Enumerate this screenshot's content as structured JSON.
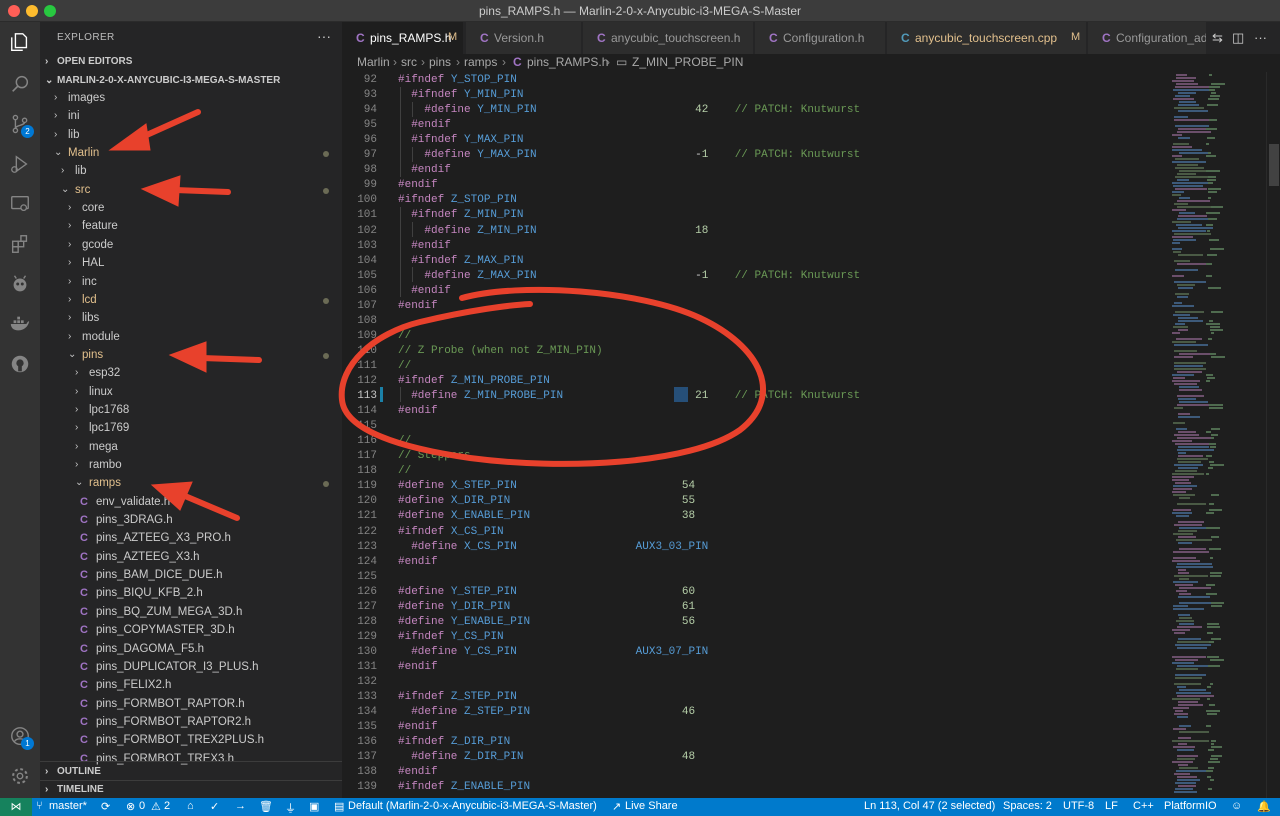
{
  "window": {
    "title": "pins_RAMPS.h — Marlin-2-0-x-Anycubic-i3-MEGA-S-Master"
  },
  "activity": {
    "scm_badge": "2",
    "accounts_badge": "1"
  },
  "explorer": {
    "header": "EXPLORER",
    "more": "···",
    "open_editors": "OPEN EDITORS",
    "root": "MARLIN-2-0-X-ANYCUBIC-I3-MEGA-S-MASTER",
    "outline": "OUTLINE",
    "timeline": "TIMELINE",
    "items": [
      {
        "label": "images",
        "type": "folder",
        "expanded": false,
        "modified": false
      },
      {
        "label": "ini",
        "type": "folder",
        "expanded": false,
        "modified": false
      },
      {
        "label": "lib",
        "type": "folder",
        "expanded": false,
        "modified": false
      },
      {
        "label": "Marlin",
        "type": "folder",
        "expanded": true,
        "modified": true
      },
      {
        "label": "lib",
        "type": "folder",
        "expanded": false,
        "modified": false
      },
      {
        "label": "src",
        "type": "folder",
        "expanded": true,
        "modified": true
      },
      {
        "label": "core",
        "type": "folder",
        "expanded": false,
        "modified": false
      },
      {
        "label": "feature",
        "type": "folder",
        "expanded": false,
        "modified": false
      },
      {
        "label": "gcode",
        "type": "folder",
        "expanded": false,
        "modified": false
      },
      {
        "label": "HAL",
        "type": "folder",
        "expanded": false,
        "modified": false
      },
      {
        "label": "inc",
        "type": "folder",
        "expanded": false,
        "modified": false
      },
      {
        "label": "lcd",
        "type": "folder",
        "expanded": false,
        "modified": true
      },
      {
        "label": "libs",
        "type": "folder",
        "expanded": false,
        "modified": false
      },
      {
        "label": "module",
        "type": "folder",
        "expanded": false,
        "modified": false
      },
      {
        "label": "pins",
        "type": "folder",
        "expanded": true,
        "modified": true
      },
      {
        "label": "esp32",
        "type": "folder",
        "expanded": false,
        "modified": false
      },
      {
        "label": "linux",
        "type": "folder",
        "expanded": false,
        "modified": false
      },
      {
        "label": "lpc1768",
        "type": "folder",
        "expanded": false,
        "modified": false
      },
      {
        "label": "lpc1769",
        "type": "folder",
        "expanded": false,
        "modified": false
      },
      {
        "label": "mega",
        "type": "folder",
        "expanded": false,
        "modified": false
      },
      {
        "label": "rambo",
        "type": "folder",
        "expanded": false,
        "modified": false
      },
      {
        "label": "ramps",
        "type": "folder",
        "expanded": true,
        "modified": true
      },
      {
        "label": "env_validate.h",
        "type": "file"
      },
      {
        "label": "pins_3DRAG.h",
        "type": "file"
      },
      {
        "label": "pins_AZTEEG_X3_PRO.h",
        "type": "file"
      },
      {
        "label": "pins_AZTEEG_X3.h",
        "type": "file"
      },
      {
        "label": "pins_BAM_DICE_DUE.h",
        "type": "file"
      },
      {
        "label": "pins_BIQU_KFB_2.h",
        "type": "file"
      },
      {
        "label": "pins_BQ_ZUM_MEGA_3D.h",
        "type": "file"
      },
      {
        "label": "pins_COPYMASTER_3D.h",
        "type": "file"
      },
      {
        "label": "pins_DAGOMA_F5.h",
        "type": "file"
      },
      {
        "label": "pins_DUPLICATOR_I3_PLUS.h",
        "type": "file"
      },
      {
        "label": "pins_FELIX2.h",
        "type": "file"
      },
      {
        "label": "pins_FORMBOT_RAPTOR.h",
        "type": "file"
      },
      {
        "label": "pins_FORMBOT_RAPTOR2.h",
        "type": "file"
      },
      {
        "label": "pins_FORMBOT_TREX2PLUS.h",
        "type": "file"
      },
      {
        "label": "pins_FORMBOT_TREX3.h",
        "type": "file"
      }
    ]
  },
  "tabs": [
    {
      "label": "pins_RAMPS.h",
      "status": "M",
      "active": true
    },
    {
      "label": "Version.h",
      "status": "",
      "active": false
    },
    {
      "label": "anycubic_touchscreen.h",
      "status": "",
      "active": false
    },
    {
      "label": "Configuration.h",
      "status": "",
      "active": false
    },
    {
      "label": "anycubic_touchscreen.cpp",
      "status": "M",
      "active": false
    },
    {
      "label": "Configuration_adv",
      "status": "",
      "active": false
    }
  ],
  "breadcrumb": [
    "Marlin",
    "src",
    "pins",
    "ramps",
    "pins_RAMPS.h",
    "Z_MIN_PROBE_PIN"
  ],
  "editor": {
    "current_line": 113,
    "lines": [
      {
        "n": 92,
        "t": "#ifndef Y_STOP_PIN"
      },
      {
        "n": 93,
        "t": "  #ifndef Y_MIN_PIN"
      },
      {
        "n": 94,
        "t": "    #define Y_MIN_PIN                        42    // PATCH: Knutwurst"
      },
      {
        "n": 95,
        "t": "  #endif"
      },
      {
        "n": 96,
        "t": "  #ifndef Y_MAX_PIN"
      },
      {
        "n": 97,
        "t": "    #define Y_MAX_PIN                        -1    // PATCH: Knutwurst"
      },
      {
        "n": 98,
        "t": "  #endif"
      },
      {
        "n": 99,
        "t": "#endif"
      },
      {
        "n": 100,
        "t": "#ifndef Z_STOP_PIN"
      },
      {
        "n": 101,
        "t": "  #ifndef Z_MIN_PIN"
      },
      {
        "n": 102,
        "t": "    #define Z_MIN_PIN                        18"
      },
      {
        "n": 103,
        "t": "  #endif"
      },
      {
        "n": 104,
        "t": "  #ifndef Z_MAX_PIN"
      },
      {
        "n": 105,
        "t": "    #define Z_MAX_PIN                        -1    // PATCH: Knutwurst"
      },
      {
        "n": 106,
        "t": "  #endif"
      },
      {
        "n": 107,
        "t": "#endif"
      },
      {
        "n": 108,
        "t": ""
      },
      {
        "n": 109,
        "t": "//"
      },
      {
        "n": 110,
        "t": "// Z Probe (when not Z_MIN_PIN)"
      },
      {
        "n": 111,
        "t": "//"
      },
      {
        "n": 112,
        "t": "#ifndef Z_MIN_PROBE_PIN"
      },
      {
        "n": 113,
        "t": "  #define Z_MIN_PROBE_PIN                    21    // PATCH: Knutwurst"
      },
      {
        "n": 114,
        "t": "#endif"
      },
      {
        "n": 115,
        "t": ""
      },
      {
        "n": 116,
        "t": "//"
      },
      {
        "n": 117,
        "t": "// Steppers"
      },
      {
        "n": 118,
        "t": "//"
      },
      {
        "n": 119,
        "t": "#define X_STEP_PIN                         54"
      },
      {
        "n": 120,
        "t": "#define X_DIR_PIN                          55"
      },
      {
        "n": 121,
        "t": "#define X_ENABLE_PIN                       38"
      },
      {
        "n": 122,
        "t": "#ifndef X_CS_PIN"
      },
      {
        "n": 123,
        "t": "  #define X_CS_PIN                  AUX3_03_PIN"
      },
      {
        "n": 124,
        "t": "#endif"
      },
      {
        "n": 125,
        "t": ""
      },
      {
        "n": 126,
        "t": "#define Y_STEP_PIN                         60"
      },
      {
        "n": 127,
        "t": "#define Y_DIR_PIN                          61"
      },
      {
        "n": 128,
        "t": "#define Y_ENABLE_PIN                       56"
      },
      {
        "n": 129,
        "t": "#ifndef Y_CS_PIN"
      },
      {
        "n": 130,
        "t": "  #define Y_CS_PIN                  AUX3_07_PIN"
      },
      {
        "n": 131,
        "t": "#endif"
      },
      {
        "n": 132,
        "t": ""
      },
      {
        "n": 133,
        "t": "#ifndef Z_STEP_PIN"
      },
      {
        "n": 134,
        "t": "  #define Z_STEP_PIN                       46"
      },
      {
        "n": 135,
        "t": "#endif"
      },
      {
        "n": 136,
        "t": "#ifndef Z_DIR_PIN"
      },
      {
        "n": 137,
        "t": "  #define Z_DIR_PIN                        48"
      },
      {
        "n": 138,
        "t": "#endif"
      },
      {
        "n": 139,
        "t": "#ifndef Z_ENABLE_PIN"
      }
    ]
  },
  "statusbar": {
    "branch": "master*",
    "errors": "0",
    "warnings": "2",
    "folder": "Default (Marlin-2-0-x-Anycubic-i3-MEGA-S-Master)",
    "live_share": "Live Share",
    "position": "Ln 113, Col 47 (2 selected)",
    "spaces": "Spaces: 2",
    "encoding": "UTF-8",
    "eol": "LF",
    "language": "C++",
    "platformio": "PlatformIO"
  },
  "colors": {
    "status_bar": "#007acc",
    "annotation": "#e8412c",
    "modified": "#e2c08d",
    "c_file_icon": "#a074c4"
  }
}
